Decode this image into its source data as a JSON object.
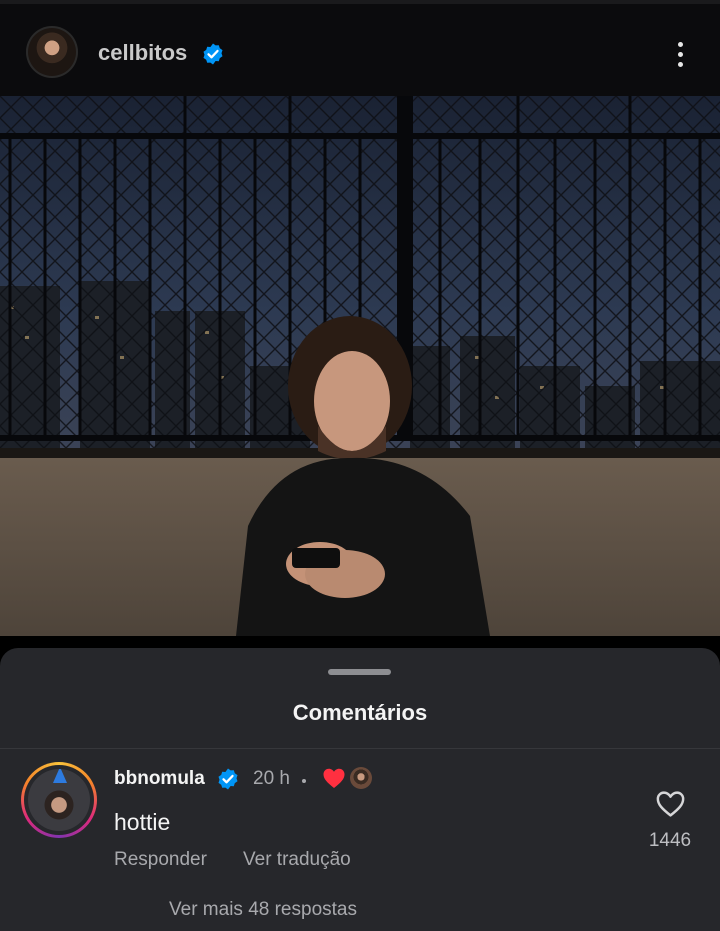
{
  "post": {
    "username": "cellbitos",
    "verified": true,
    "icons": {
      "more": "more-vertical-icon",
      "verified": "verified-badge-icon"
    }
  },
  "photo": {
    "subject": "photo"
  },
  "comments_sheet": {
    "title": "Comentários",
    "comment": {
      "username": "bbnomula",
      "verified": true,
      "time": "20 h",
      "liked_by_author": true,
      "text": "hottie",
      "reply_label": "Responder",
      "translate_label": "Ver tradução",
      "like_count": "1446",
      "view_replies_label": "Ver mais 48 respostas"
    }
  },
  "colors": {
    "header_bg": "#0b0b0d",
    "sheet_bg": "#26272b",
    "verified_blue": "#0095f6",
    "heart_red": "#ff3040",
    "muted_text": "#a8a9ad"
  }
}
